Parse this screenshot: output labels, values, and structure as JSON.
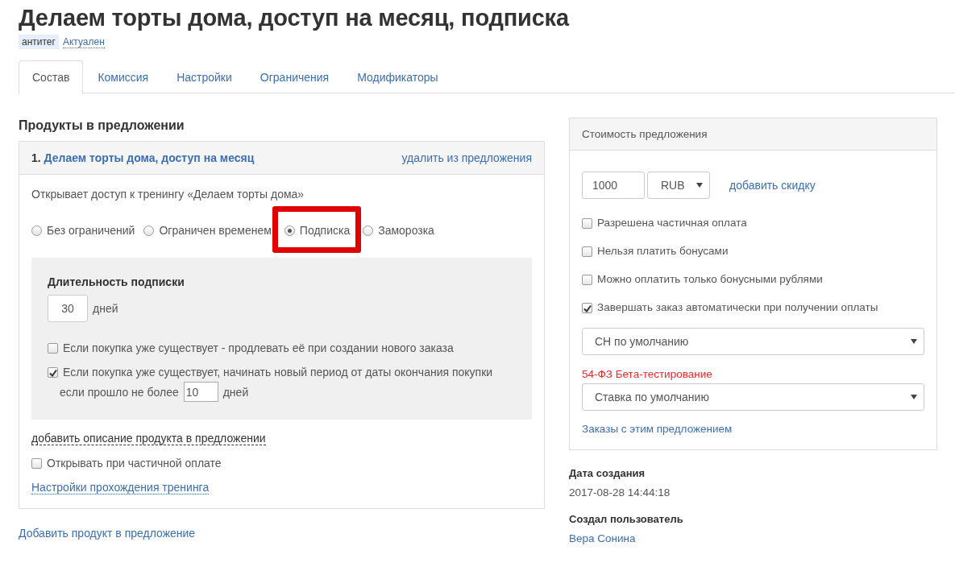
{
  "title": "Делаем торты дома, доступ на месяц, подписка",
  "tags": [
    {
      "label": "антитег",
      "kind": "badge"
    },
    {
      "label": "Актуален",
      "kind": "link"
    }
  ],
  "tabs": [
    {
      "label": "Состав",
      "selected": true
    },
    {
      "label": "Комиссия",
      "selected": false
    },
    {
      "label": "Настройки",
      "selected": false
    },
    {
      "label": "Ограничения",
      "selected": false
    },
    {
      "label": "Модификаторы",
      "selected": false
    }
  ],
  "products_section": {
    "heading": "Продукты в предложении",
    "products": [
      {
        "number": "1.",
        "name": "Делаем торты дома, доступ на месяц",
        "remove_link": "удалить из предложения",
        "description": "Открывает доступ к тренингу «Делаем торты дома»",
        "access_types": [
          {
            "label": "Без ограничений",
            "selected": false,
            "highlighted": false
          },
          {
            "label": "Ограничен временем",
            "selected": false,
            "highlighted": false
          },
          {
            "label": "Подписка",
            "selected": true,
            "highlighted": true
          },
          {
            "label": "Заморозка",
            "selected": false,
            "highlighted": false
          }
        ],
        "subscription": {
          "heading": "Длительность подписки",
          "duration": "30",
          "unit": "дней",
          "options": [
            {
              "label": "Если покупка уже существует - продлевать её при создании нового заказа",
              "checked": false
            },
            {
              "label": "Если покупка уже существует, начинать новый период от даты окончания покупки",
              "checked": true,
              "sub_prefix": "если прошло не более",
              "sub_value": "10",
              "sub_unit": "дней"
            }
          ]
        },
        "add_description_link": "добавить описание продукта в предложении",
        "partial_payment": {
          "label": "Открывать при частичной оплате",
          "checked": false
        },
        "training_settings_link": "Настройки прохождения тренинга"
      }
    ],
    "add_product_link": "Добавить продукт в предложение"
  },
  "price": {
    "heading": "Стоимость предложения",
    "amount": "1000",
    "currency": "RUB",
    "discount_link": "добавить скидку",
    "options": [
      {
        "label": "Разрешена частичная оплата",
        "checked": false
      },
      {
        "label": "Нельзя платить бонусами",
        "checked": false
      },
      {
        "label": "Можно оплатить только бонусными рублями",
        "checked": false
      },
      {
        "label": "Завершать заказ автоматически при получении оплаты",
        "checked": true
      }
    ],
    "tax_select": "СН по умолчанию",
    "beta_label": "54-ФЗ Бета-тестирование",
    "rate_select": "Ставка по умолчанию",
    "orders_link": "Заказы с этим предложением"
  },
  "meta": [
    {
      "label": "Дата создания",
      "value": "2017-08-28 14:44:18",
      "kind": "text"
    },
    {
      "label": "Создал пользователь",
      "value": "Вера Сонина",
      "kind": "link"
    }
  ]
}
